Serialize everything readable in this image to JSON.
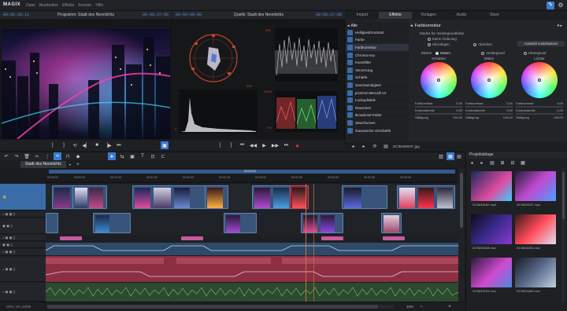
{
  "app": {
    "logo": "MAGIX",
    "menu": [
      "Datei",
      "Bearbeiten",
      "Effekte",
      "Fenster",
      "Hilfe"
    ]
  },
  "program_monitor": {
    "timecode_left": "00:00:36:11",
    "title": "Programm: Stadt des Neonlichts",
    "timecode_right": "00:08:37:06"
  },
  "source_monitor": {
    "timecode_left": "00:00:00:00",
    "title": "Quelle: Stadt des Neonlichts",
    "timecode_right": "00:08:37:06"
  },
  "scopes": {
    "tick_0": "0",
    "tick_255": "255",
    "pct_0": "0%",
    "pct_100": "100%"
  },
  "panel_tabs": [
    "Import",
    "Effekte",
    "Vorlagen",
    "Audio",
    "Store"
  ],
  "effects": {
    "header": "Alle",
    "items": [
      "Helligkeit/Kontrast",
      "Farbe",
      "Farbkorrektur",
      "Chroma Key",
      "Kunstfilter",
      "Verzerrung",
      "Schärfe",
      "Geschwindigkeit",
      "proDAD Mercalli V2",
      "Lookupfabrik",
      "Rauschen",
      "Broadcast-Farbe",
      "Stanzformen",
      "Gaussische Unschärfe"
    ],
    "selected_index": 2
  },
  "color_correction": {
    "title": "Farbkorrektur",
    "mode_label": "Modus für Vordergrundfarbe",
    "option_none": "Keine Änderung",
    "option_add": "Hinzufügen",
    "option_subtract": "Abziehen",
    "reset_button": "Auswahl zurücksetzen",
    "range_label": "Ebene",
    "range_master": "Master",
    "range_foreground": "Vordergrund",
    "range_background": "Hintergrund",
    "wheels": [
      {
        "name": "Schatten",
        "a_label": "Farbkontrast",
        "a_value": "0,00",
        "b_label": "Kontrastbreite",
        "b_value": "0,00",
        "c_label": "Sättigung",
        "c_value": "128,00"
      },
      {
        "name": "Mitten",
        "a_label": "Farbkontrast",
        "a_value": "0,00",
        "b_label": "Kontrastbreite",
        "b_value": "0,00",
        "c_label": "Sättigung",
        "c_value": "128,00"
      },
      {
        "name": "Lichter",
        "a_label": "Farbkontrast",
        "a_value": "0,00",
        "b_label": "Kontrastbreite",
        "b_value": "0,00",
        "c_label": "Sättigung",
        "c_value": "128,00"
      }
    ],
    "file_label": "DCIM490037.jpg"
  },
  "timeline": {
    "project_tab": "Stadt des Neonlichts",
    "ruler": [
      "00:00:00",
      "00:00:30",
      "00:01:00",
      "00:01:30",
      "00:02:00",
      "00:02:30",
      "00:03:00",
      "00:03:30",
      "00:04:00",
      "00:04:30",
      "00:05:00"
    ],
    "playhead_tc": "00:03:23",
    "zoom": "10%",
    "status": "CPU: 2% 13/30"
  },
  "project_bin": {
    "title": "Projektablage",
    "items": [
      "DCIM48182.mp4",
      "DCIM48187.mp4",
      "DCIM48448.mov",
      "DCIM48454.mov",
      "DCIM48763.mov",
      "DCIM49469.mov"
    ]
  },
  "colors": {
    "accent": "#3a7bd5",
    "track_blue": "#3b5f86",
    "track_red": "#8c2f43",
    "track_green": "#3f6b40",
    "playhead": "#d0703a",
    "label_pink": "#c85a9c"
  }
}
